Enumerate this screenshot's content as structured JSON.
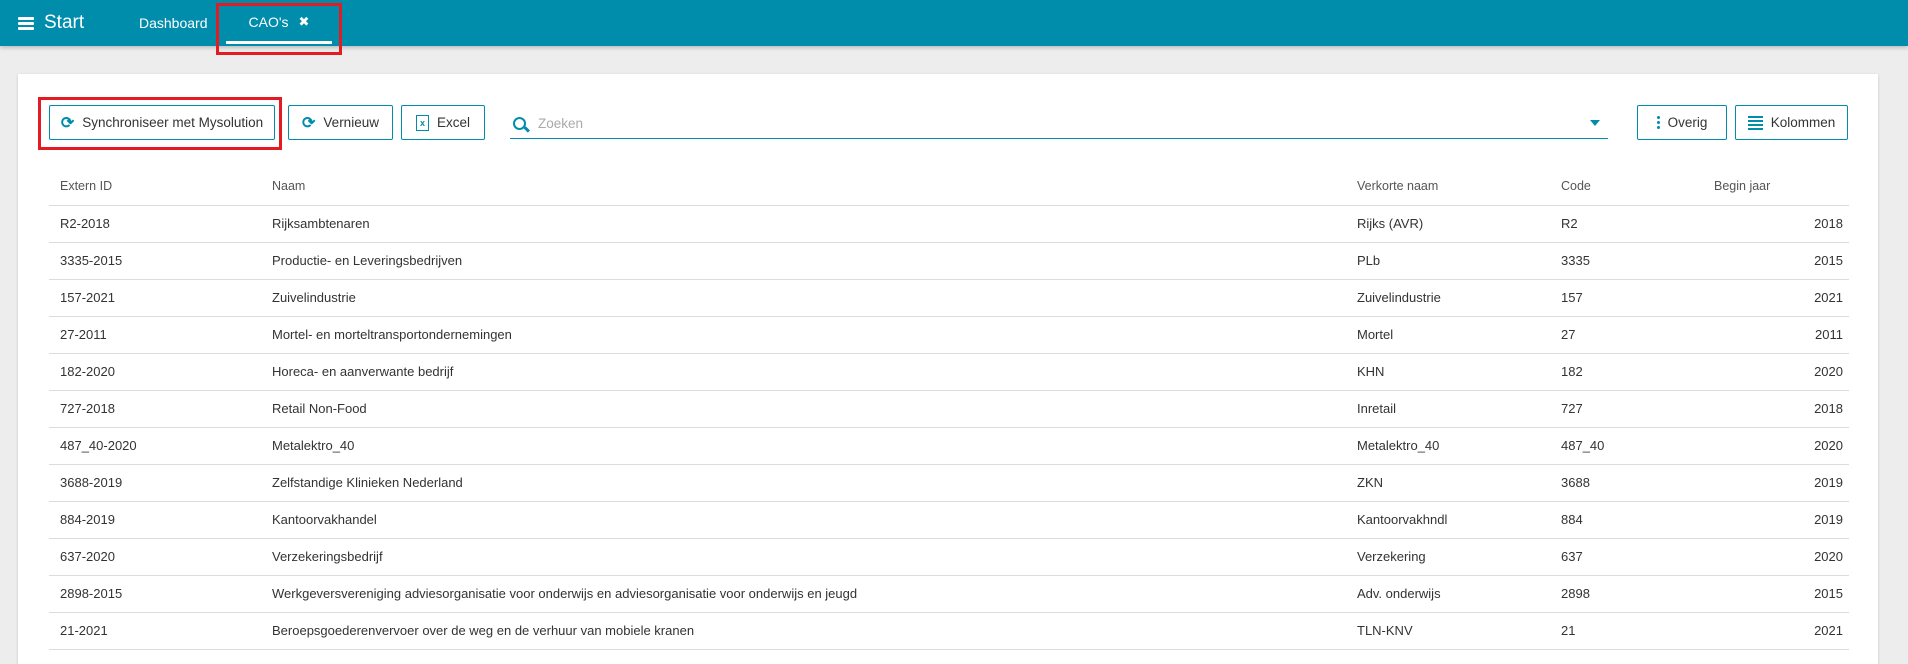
{
  "topbar": {
    "start_label": "Start",
    "tabs": [
      {
        "label": "Dashboard"
      },
      {
        "label": "CAO's"
      }
    ]
  },
  "toolbar": {
    "sync_label": "Synchroniseer met Mysolution",
    "refresh_label": "Vernieuw",
    "excel_label": "Excel",
    "overig_label": "Overig",
    "kolommen_label": "Kolommen"
  },
  "search": {
    "placeholder": "Zoeken",
    "value": ""
  },
  "table": {
    "columns": [
      "Extern ID",
      "Naam",
      "Verkorte naam",
      "Code",
      "Begin jaar"
    ],
    "rows": [
      [
        "R2-2018",
        "Rijksambtenaren",
        "Rijks (AVR)",
        "R2",
        "2018"
      ],
      [
        "3335-2015",
        "Productie- en Leveringsbedrijven",
        "PLb",
        "3335",
        "2015"
      ],
      [
        "157-2021",
        "Zuivelindustrie",
        "Zuivelindustrie",
        "157",
        "2021"
      ],
      [
        "27-2011",
        "Mortel- en morteltransportondernemingen",
        "Mortel",
        "27",
        "2011"
      ],
      [
        "182-2020",
        "Horeca- en aanverwante bedrijf",
        "KHN",
        "182",
        "2020"
      ],
      [
        "727-2018",
        "Retail Non-Food",
        "Inretail",
        "727",
        "2018"
      ],
      [
        "487_40-2020",
        "Metalektro_40",
        "Metalektro_40",
        "487_40",
        "2020"
      ],
      [
        "3688-2019",
        "Zelfstandige Klinieken Nederland",
        "ZKN",
        "3688",
        "2019"
      ],
      [
        "884-2019",
        "Kantoorvakhandel",
        "Kantoorvakhndl",
        "884",
        "2019"
      ],
      [
        "637-2020",
        "Verzekeringsbedrijf",
        "Verzekering",
        "637",
        "2020"
      ],
      [
        "2898-2015",
        "Werkgeversvereniging adviesorganisatie voor onderwijs en adviesorganisatie voor onderwijs en jeugd",
        "Adv. onderwijs",
        "2898",
        "2015"
      ],
      [
        "21-2021",
        "Beroepsgoederenvervoer over de weg en de verhuur van mobiele kranen",
        "TLN-KNV",
        "21",
        "2021"
      ]
    ]
  }
}
